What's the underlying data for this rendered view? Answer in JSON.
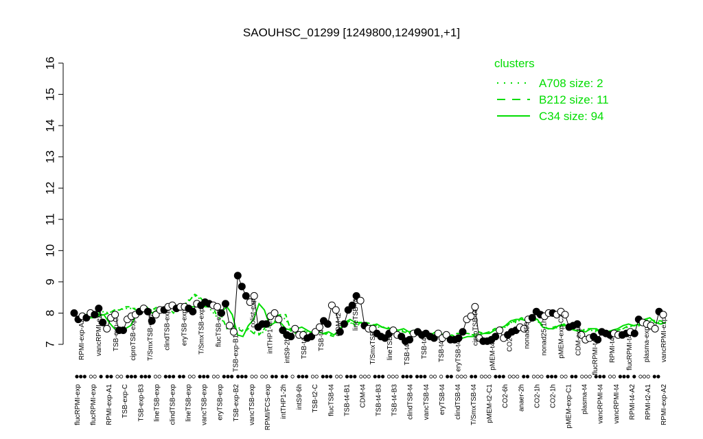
{
  "chart_data": {
    "type": "line",
    "title": "SAOUHSC_01299 [1249800,1249901,+1]",
    "xlabel": "",
    "ylabel": "",
    "ylim": [
      7,
      16
    ],
    "yticks": [
      7,
      8,
      9,
      10,
      11,
      12,
      13,
      14,
      15,
      16
    ],
    "grid": false,
    "legend": {
      "title": "clusters",
      "placement": "top-right",
      "color": "#00dd00",
      "entries": [
        {
          "label": "A708 size: 2",
          "style": "dotted"
        },
        {
          "label": "B212 size: 11",
          "style": "dashed"
        },
        {
          "label": "C34 size: 94",
          "style": "solid"
        }
      ]
    },
    "colors": {
      "line": "#00dd00",
      "point_fill_dark": "#000000",
      "point_fill_light": "#ffffff"
    },
    "x_labels": [
      "flucRPMI-exp",
      "flucRPMI-exp",
      "RPMI-exp-A1",
      "TSB-exp-C",
      "TSB-exp-B3",
      "lineTSB-exp",
      "clindTSB-exp",
      "lineTSB-exp",
      "vancTSB-exp",
      "eryTSB-exp",
      "TSB-exp-B2",
      "vancTSB-exp",
      "RPMI/FCS-exp",
      "intTHP1-2h",
      "intS9-6h",
      "TSB-t2-C",
      "flucTSB-t4",
      "TSB-t4-B1",
      "CDM-t4",
      "TSB-t4-B3",
      "TSB-t4-B3",
      "clindTSB-t4",
      "vancTSB-t4",
      "eryTSB-t4",
      "clindTSB-t4",
      "T/SmxTSB-t4",
      "pMEM-t2-C1",
      "CO2-6h",
      "anaer-2h",
      "CO2-1h",
      "CO2-1h",
      "pMEM-exp-C1",
      "plasma-t4",
      "vancRPMI-t4",
      "vancRPMI-t4",
      "RPMI-t4-A2",
      "RPMI-t2-A1",
      "RPMI-exp-A2"
    ],
    "annotations": [
      "RPMI-exp-A2",
      "vancRPMI-exp",
      "TSB-exp-C",
      "ciproTSB-exp",
      "T/SmxTSB-exp",
      "clindTSB-exp",
      "eryTSB-exp",
      "T/SmxTSB-exp",
      "flucTSB-exp",
      "TSB-exp-B1",
      "colist-exp",
      "intTHP1-6h",
      "intS9-2h",
      "TSB-t4",
      "TSB-t4",
      "CDM-t2",
      "lineTSB-t4",
      "T/SmxTSB",
      "lineTSB",
      "TSB-t4",
      "TSB-t4",
      "TSB-t4",
      "eryTSB-t4",
      "ciproTSB-t4",
      "pMEM-t4",
      "CO2",
      "nonad50",
      "nonad25-1h",
      "pMEM-exp-C2",
      "CDM-exp",
      "flucRPMI-t4",
      "RPMI-t4",
      "flucRPMI-t4",
      "plasma-exp",
      "vancRPMI-exp"
    ],
    "series": [
      {
        "style": "solid",
        "values": [
          7.9,
          7.85,
          7.85,
          7.9,
          7.95,
          7.7,
          7.5,
          7.45,
          7.5,
          7.6,
          7.9,
          8.2,
          8.2,
          8.0,
          8.1,
          8.15,
          8.2,
          8.2,
          8.2,
          8.15,
          8.2,
          8.2,
          8.25,
          8.2,
          8.2,
          8.2,
          8.05,
          8.2,
          7.95,
          7.3,
          7.25,
          7.6,
          7.8,
          8.3,
          8.1,
          7.6,
          7.7,
          7.7,
          7.5,
          7.45,
          7.5,
          7.55,
          7.45,
          7.35,
          7.4,
          7.35,
          7.4,
          7.3,
          7.45,
          7.7,
          7.8,
          7.7,
          7.7,
          7.5,
          7.6,
          7.65,
          7.55,
          7.5,
          7.5,
          7.45,
          7.5,
          7.4,
          7.45,
          7.35,
          7.3,
          7.3,
          7.4,
          7.35,
          7.2,
          7.3,
          7.2,
          7.2,
          7.25,
          7.25,
          7.3,
          7.35,
          7.35,
          7.45,
          7.5,
          7.6,
          7.75,
          7.8,
          7.8,
          7.75,
          7.8,
          7.8,
          7.55,
          7.5,
          7.5,
          7.6,
          7.65,
          7.5,
          7.45,
          7.45,
          7.4,
          7.5,
          7.5,
          7.4,
          7.4,
          7.45,
          7.5,
          7.6,
          7.65,
          7.6,
          7.65,
          7.8,
          7.85,
          7.7,
          7.65,
          7.7
        ]
      },
      {
        "style": "dashed",
        "values": [
          7.95,
          7.95,
          8.0,
          7.95,
          7.95,
          8.0,
          8.1,
          8.1,
          8.2,
          8.2,
          8.1,
          8.0,
          8.05,
          8.1,
          8.2,
          8.1,
          8.2,
          8.0,
          8.15,
          8.25,
          8.4,
          8.6,
          8.5,
          8.3,
          8.35,
          7.95,
          7.9,
          7.5,
          7.6,
          7.5,
          7.4,
          7.5,
          7.35,
          7.3,
          7.5,
          7.9,
          7.9,
          7.95,
          7.95,
          7.4,
          7.35,
          7.4,
          7.45,
          7.35,
          7.4,
          7.35,
          7.3,
          7.25,
          7.5,
          7.65,
          7.75,
          7.6,
          7.7,
          7.7,
          7.65,
          7.6,
          7.55,
          7.55,
          7.45,
          7.45,
          7.4,
          7.35,
          7.45,
          7.3,
          7.35,
          7.35,
          7.3,
          7.3,
          7.25,
          7.2,
          7.35,
          7.35,
          7.35,
          7.3,
          7.4,
          7.35,
          7.4,
          7.5,
          7.55,
          7.55,
          7.7,
          7.75,
          7.85,
          7.8,
          7.85,
          7.8,
          7.6,
          7.5,
          7.55,
          7.6,
          7.6,
          7.5,
          7.45,
          7.4,
          7.5,
          7.5,
          7.45,
          7.4,
          7.4,
          7.35,
          7.45,
          7.5,
          7.6,
          7.6,
          7.6,
          7.75,
          7.8,
          7.75,
          7.75,
          7.7
        ]
      },
      {
        "style": "dotted",
        "values": [
          8.0,
          7.95,
          7.95,
          8.0,
          8.05,
          8.0,
          8.1,
          8.1,
          8.15,
          8.15,
          8.15,
          8.1,
          8.1,
          8.1,
          8.15,
          8.1,
          8.15,
          8.15,
          8.2,
          8.25,
          8.45,
          8.55,
          8.45,
          8.3,
          8.1,
          7.9,
          7.8,
          7.55,
          7.6,
          7.55,
          7.45,
          7.45,
          7.4,
          7.35,
          7.4,
          7.6,
          7.75,
          7.9,
          7.8,
          7.5,
          7.4,
          7.4,
          7.4,
          7.4,
          7.4,
          7.35,
          7.35,
          7.3,
          7.45,
          7.6,
          7.7,
          7.6,
          7.65,
          7.65,
          7.6,
          7.55,
          7.55,
          7.5,
          7.45,
          7.4,
          7.45,
          7.35,
          7.4,
          7.3,
          7.3,
          7.3,
          7.3,
          7.25,
          7.2,
          7.25,
          7.35,
          7.35,
          7.35,
          7.3,
          7.35,
          7.35,
          7.4,
          7.45,
          7.5,
          7.55,
          7.7,
          7.7,
          7.8,
          7.8,
          7.8,
          7.75,
          7.55,
          7.5,
          7.5,
          7.55,
          7.6,
          7.5,
          7.45,
          7.4,
          7.45,
          7.45,
          7.4,
          7.4,
          7.4,
          7.35,
          7.45,
          7.5,
          7.55,
          7.6,
          7.6,
          7.7,
          7.75,
          7.7,
          7.7,
          7.7
        ]
      }
    ],
    "points": [
      {
        "y": 8.0,
        "fill": "dark"
      },
      {
        "y": 7.8,
        "fill": "dark"
      },
      {
        "y": 7.9,
        "fill": "light"
      },
      {
        "y": 7.85,
        "fill": "dark"
      },
      {
        "y": 8.0,
        "fill": "light"
      },
      {
        "y": 7.95,
        "fill": "dark"
      },
      {
        "y": 8.15,
        "fill": "dark"
      },
      {
        "y": 7.7,
        "fill": "dark"
      },
      {
        "y": 7.5,
        "fill": "light"
      },
      {
        "y": 7.85,
        "fill": "light"
      },
      {
        "y": 7.95,
        "fill": "light"
      },
      {
        "y": 7.45,
        "fill": "dark"
      },
      {
        "y": 7.45,
        "fill": "dark"
      },
      {
        "y": 7.8,
        "fill": "light"
      },
      {
        "y": 7.9,
        "fill": "light"
      },
      {
        "y": 7.95,
        "fill": "light"
      },
      {
        "y": 8.05,
        "fill": "dark"
      },
      {
        "y": 8.15,
        "fill": "light"
      },
      {
        "y": 8.05,
        "fill": "dark"
      },
      {
        "y": 7.75,
        "fill": "dark"
      },
      {
        "y": 7.95,
        "fill": "light"
      },
      {
        "y": 8.1,
        "fill": "light"
      },
      {
        "y": 8.1,
        "fill": "dark"
      },
      {
        "y": 8.2,
        "fill": "light"
      },
      {
        "y": 8.25,
        "fill": "light"
      },
      {
        "y": 8.15,
        "fill": "dark"
      },
      {
        "y": 8.2,
        "fill": "light"
      },
      {
        "y": 8.2,
        "fill": "light"
      },
      {
        "y": 8.15,
        "fill": "dark"
      },
      {
        "y": 8.05,
        "fill": "dark"
      },
      {
        "y": 8.3,
        "fill": "light"
      },
      {
        "y": 8.25,
        "fill": "dark"
      },
      {
        "y": 8.35,
        "fill": "dark"
      },
      {
        "y": 8.3,
        "fill": "dark"
      },
      {
        "y": 8.25,
        "fill": "light"
      },
      {
        "y": 8.2,
        "fill": "light"
      },
      {
        "y": 8.0,
        "fill": "dark"
      },
      {
        "y": 8.3,
        "fill": "dark"
      },
      {
        "y": 7.6,
        "fill": "light"
      },
      {
        "y": 7.4,
        "fill": "light"
      },
      {
        "y": 9.2,
        "fill": "dark"
      },
      {
        "y": 8.85,
        "fill": "dark"
      },
      {
        "y": 8.55,
        "fill": "dark"
      },
      {
        "y": 8.35,
        "fill": "light"
      },
      {
        "y": 8.55,
        "fill": "light"
      },
      {
        "y": 7.55,
        "fill": "dark"
      },
      {
        "y": 7.65,
        "fill": "dark"
      },
      {
        "y": 7.65,
        "fill": "dark"
      },
      {
        "y": 7.9,
        "fill": "light"
      },
      {
        "y": 8.0,
        "fill": "light"
      },
      {
        "y": 7.8,
        "fill": "light"
      },
      {
        "y": 7.45,
        "fill": "dark"
      },
      {
        "y": 7.3,
        "fill": "dark"
      },
      {
        "y": 7.25,
        "fill": "dark"
      },
      {
        "y": 7.5,
        "fill": "light"
      },
      {
        "y": 7.3,
        "fill": "light"
      },
      {
        "y": 7.3,
        "fill": "light"
      },
      {
        "y": 7.2,
        "fill": "dark"
      },
      {
        "y": 7.25,
        "fill": "dark"
      },
      {
        "y": 7.4,
        "fill": "light"
      },
      {
        "y": 7.55,
        "fill": "light"
      },
      {
        "y": 7.75,
        "fill": "dark"
      },
      {
        "y": 7.65,
        "fill": "dark"
      },
      {
        "y": 8.25,
        "fill": "light"
      },
      {
        "y": 8.1,
        "fill": "light"
      },
      {
        "y": 7.4,
        "fill": "dark"
      },
      {
        "y": 7.65,
        "fill": "dark"
      },
      {
        "y": 8.1,
        "fill": "dark"
      },
      {
        "y": 8.25,
        "fill": "dark"
      },
      {
        "y": 8.55,
        "fill": "dark"
      },
      {
        "y": 8.4,
        "fill": "light"
      },
      {
        "y": 7.6,
        "fill": "dark"
      },
      {
        "y": 7.5,
        "fill": "light"
      },
      {
        "y": 7.5,
        "fill": "light"
      },
      {
        "y": 7.35,
        "fill": "dark"
      },
      {
        "y": 7.25,
        "fill": "dark"
      },
      {
        "y": 7.2,
        "fill": "dark"
      },
      {
        "y": 7.35,
        "fill": "dark"
      },
      {
        "y": 7.45,
        "fill": "light"
      },
      {
        "y": 7.3,
        "fill": "light"
      },
      {
        "y": 7.25,
        "fill": "dark"
      },
      {
        "y": 7.1,
        "fill": "dark"
      },
      {
        "y": 7.15,
        "fill": "dark"
      },
      {
        "y": 7.35,
        "fill": "light"
      },
      {
        "y": 7.4,
        "fill": "dark"
      },
      {
        "y": 7.3,
        "fill": "dark"
      },
      {
        "y": 7.35,
        "fill": "dark"
      },
      {
        "y": 7.25,
        "fill": "dark"
      },
      {
        "y": 7.2,
        "fill": "dark"
      },
      {
        "y": 7.35,
        "fill": "light"
      },
      {
        "y": 7.2,
        "fill": "light"
      },
      {
        "y": 7.3,
        "fill": "light"
      },
      {
        "y": 7.15,
        "fill": "dark"
      },
      {
        "y": 7.15,
        "fill": "dark"
      },
      {
        "y": 7.2,
        "fill": "dark"
      },
      {
        "y": 7.4,
        "fill": "dark"
      },
      {
        "y": 7.8,
        "fill": "light"
      },
      {
        "y": 7.9,
        "fill": "light"
      },
      {
        "y": 8.2,
        "fill": "light"
      },
      {
        "y": 7.2,
        "fill": "light"
      },
      {
        "y": 7.1,
        "fill": "dark"
      },
      {
        "y": 7.1,
        "fill": "dark"
      },
      {
        "y": 7.15,
        "fill": "dark"
      },
      {
        "y": 7.25,
        "fill": "dark"
      },
      {
        "y": 7.45,
        "fill": "light"
      },
      {
        "y": 7.2,
        "fill": "light"
      },
      {
        "y": 7.3,
        "fill": "dark"
      },
      {
        "y": 7.4,
        "fill": "dark"
      },
      {
        "y": 7.45,
        "fill": "dark"
      },
      {
        "y": 7.55,
        "fill": "light"
      },
      {
        "y": 7.5,
        "fill": "light"
      },
      {
        "y": 7.8,
        "fill": "light"
      },
      {
        "y": 7.85,
        "fill": "dark"
      },
      {
        "y": 8.05,
        "fill": "dark"
      },
      {
        "y": 7.95,
        "fill": "dark"
      },
      {
        "y": 7.9,
        "fill": "light"
      },
      {
        "y": 8.0,
        "fill": "light"
      },
      {
        "y": 8.0,
        "fill": "dark"
      },
      {
        "y": 7.95,
        "fill": "light"
      },
      {
        "y": 8.05,
        "fill": "light"
      },
      {
        "y": 7.95,
        "fill": "light"
      },
      {
        "y": 7.55,
        "fill": "dark"
      },
      {
        "y": 7.6,
        "fill": "dark"
      },
      {
        "y": 7.65,
        "fill": "dark"
      },
      {
        "y": 7.3,
        "fill": "light"
      },
      {
        "y": 7.15,
        "fill": "light"
      },
      {
        "y": 7.2,
        "fill": "light"
      },
      {
        "y": 7.25,
        "fill": "dark"
      },
      {
        "y": 7.15,
        "fill": "dark"
      },
      {
        "y": 7.4,
        "fill": "dark"
      },
      {
        "y": 7.35,
        "fill": "dark"
      },
      {
        "y": 7.3,
        "fill": "dark"
      },
      {
        "y": 7.35,
        "fill": "light"
      },
      {
        "y": 7.3,
        "fill": "light"
      },
      {
        "y": 7.3,
        "fill": "dark"
      },
      {
        "y": 7.35,
        "fill": "dark"
      },
      {
        "y": 7.4,
        "fill": "light"
      },
      {
        "y": 7.35,
        "fill": "dark"
      },
      {
        "y": 7.8,
        "fill": "dark"
      },
      {
        "y": 7.7,
        "fill": "light"
      },
      {
        "y": 7.65,
        "fill": "light"
      },
      {
        "y": 7.6,
        "fill": "light"
      },
      {
        "y": 7.5,
        "fill": "light"
      },
      {
        "y": 8.05,
        "fill": "dark"
      },
      {
        "y": 7.95,
        "fill": "light"
      }
    ],
    "rug": [
      {
        "n": 3,
        "fill": "dark"
      },
      {
        "n": 2,
        "fill": "light"
      },
      {
        "n": 1,
        "fill": "dark"
      },
      {
        "n": 2,
        "fill": "dark"
      },
      {
        "n": 2,
        "fill": "light"
      },
      {
        "n": 3,
        "fill": "dark"
      },
      {
        "n": 3,
        "fill": "dark"
      },
      {
        "n": 2,
        "fill": "light"
      },
      {
        "n": 3,
        "fill": "dark"
      },
      {
        "n": 2,
        "fill": "dark"
      },
      {
        "n": 2,
        "fill": "light"
      },
      {
        "n": 3,
        "fill": "dark"
      },
      {
        "n": 2,
        "fill": "light"
      },
      {
        "n": 3,
        "fill": "dark"
      },
      {
        "n": 3,
        "fill": "dark"
      },
      {
        "n": 2,
        "fill": "light"
      },
      {
        "n": 2,
        "fill": "light"
      },
      {
        "n": 2,
        "fill": "dark"
      },
      {
        "n": 2,
        "fill": "dark"
      },
      {
        "n": 1,
        "fill": "light"
      },
      {
        "n": 3,
        "fill": "dark"
      },
      {
        "n": 2,
        "fill": "light"
      },
      {
        "n": 3,
        "fill": "dark"
      },
      {
        "n": 2,
        "fill": "light"
      },
      {
        "n": 3,
        "fill": "dark"
      },
      {
        "n": 3,
        "fill": "light"
      },
      {
        "n": 3,
        "fill": "dark"
      },
      {
        "n": 3,
        "fill": "light"
      },
      {
        "n": 3,
        "fill": "dark"
      },
      {
        "n": 3,
        "fill": "dark"
      },
      {
        "n": 2,
        "fill": "light"
      },
      {
        "n": 1,
        "fill": "light"
      },
      {
        "n": 2,
        "fill": "dark"
      },
      {
        "n": 3,
        "fill": "light"
      },
      {
        "n": 2,
        "fill": "dark"
      },
      {
        "n": 3,
        "fill": "light"
      },
      {
        "n": 3,
        "fill": "dark"
      },
      {
        "n": 3,
        "fill": "light"
      },
      {
        "n": 2,
        "fill": "dark"
      },
      {
        "n": 3,
        "fill": "light"
      },
      {
        "n": 3,
        "fill": "dark"
      },
      {
        "n": 2,
        "fill": "light"
      },
      {
        "n": 2,
        "fill": "dark"
      },
      {
        "n": 3,
        "fill": "light"
      },
      {
        "n": 3,
        "fill": "dark"
      },
      {
        "n": 2,
        "fill": "light"
      },
      {
        "n": 3,
        "fill": "dark"
      },
      {
        "n": 1,
        "fill": "dark"
      },
      {
        "n": 3,
        "fill": "light"
      },
      {
        "n": 2,
        "fill": "dark"
      }
    ]
  }
}
